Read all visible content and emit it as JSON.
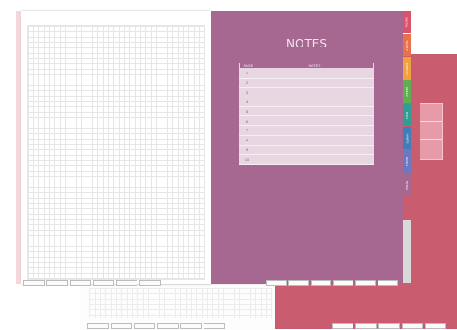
{
  "page": {
    "title": "NOTES",
    "table": {
      "headers": [
        "PAGE",
        "NOTES"
      ],
      "rows": [
        "1",
        "2",
        "3",
        "4",
        "5",
        "6",
        "7",
        "8",
        "9",
        "10"
      ]
    }
  },
  "side_tabs": [
    {
      "label": "DIGITAL",
      "color": "#d9536a"
    },
    {
      "label": "YEARLY",
      "color": "#e6734c"
    },
    {
      "label": "MONTHLY",
      "color": "#f0a13b"
    },
    {
      "label": "WEEKLY",
      "color": "#5fae4f"
    },
    {
      "label": "DAILY",
      "color": "#2f9e92"
    },
    {
      "label": "HABITS",
      "color": "#3f7fb8"
    },
    {
      "label": "GOALS",
      "color": "#6d78c0"
    },
    {
      "label": "NOTES",
      "color": "#a66890"
    },
    {
      "label": "",
      "color": "#c95c6e"
    }
  ],
  "colors": {
    "notes_page": "#a66890",
    "back_page": "#c95c6e",
    "table_bg": "#e8d7e3"
  }
}
